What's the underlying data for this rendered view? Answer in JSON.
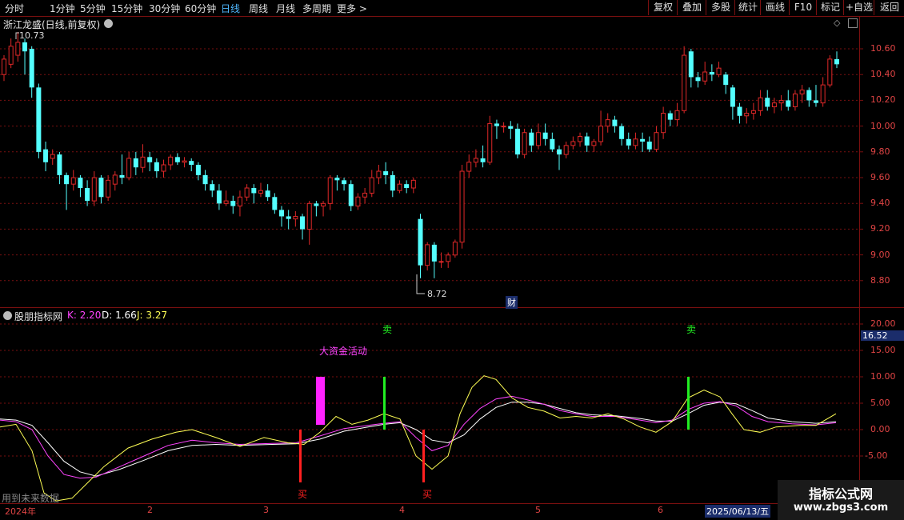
{
  "toolbar": {
    "periods": [
      {
        "label": "分时",
        "active": false
      },
      {
        "label": "1分钟",
        "active": false
      },
      {
        "label": "5分钟",
        "active": false
      },
      {
        "label": "15分钟",
        "active": false
      },
      {
        "label": "30分钟",
        "active": false
      },
      {
        "label": "60分钟",
        "active": false
      },
      {
        "label": "日线",
        "active": true
      },
      {
        "label": "周线",
        "active": false
      },
      {
        "label": "月线",
        "active": false
      },
      {
        "label": "多周期",
        "active": false
      },
      {
        "label": "更多 >",
        "active": false
      }
    ],
    "actions": [
      "复权",
      "叠加",
      "多股",
      "统计",
      "画线",
      "F10",
      "标记",
      "+自选",
      "返回"
    ]
  },
  "main_panel": {
    "title": "浙江龙盛(日线,前复权)",
    "y_ticks": [
      "10.60",
      "10.40",
      "10.20",
      "10.00",
      "9.80",
      "9.60",
      "9.40",
      "9.20",
      "9.00",
      "8.80"
    ],
    "high_label": "10.73",
    "low_label": "8.72",
    "finance_marker": "财"
  },
  "indicator_panel": {
    "name": "股朋指标网",
    "k_label": "K: 2.20",
    "d_label": "D: 1.66",
    "j_label": "J: 3.27",
    "y_ticks": [
      "20.00",
      "15.00",
      "10.00",
      "5.00",
      "0.00",
      "-5.00"
    ],
    "current_value": "16.52",
    "big_money_label": "大资金活动",
    "signals": [
      {
        "type": "sell",
        "text": "卖"
      },
      {
        "type": "sell",
        "text": "卖"
      },
      {
        "type": "buy",
        "text": "买"
      },
      {
        "type": "buy",
        "text": "买"
      }
    ],
    "future_data_note": "用到未来数据"
  },
  "time_axis": {
    "labels": [
      "2024年",
      "2",
      "3",
      "4",
      "5",
      "6"
    ],
    "cursor_date": "2025/06/13/五"
  },
  "watermark": {
    "title": "指标公式网",
    "url": "www.zbgs3.com"
  },
  "colors": {
    "up": "#e02828",
    "down": "#54ffff",
    "k_line": "#ffffff",
    "d_line": "#ff44ff",
    "j_line": "#ffff55",
    "buy": "#ff2020",
    "sell": "#22ee22",
    "big_money": "#ff22ff",
    "grid": "#7a1010"
  },
  "chart_data": {
    "type": "candlestick",
    "ylim": [
      8.7,
      10.75
    ],
    "candles": [
      [
        10.4,
        10.52,
        10.35,
        10.55
      ],
      [
        10.48,
        10.62,
        10.45,
        10.68
      ],
      [
        10.55,
        10.65,
        10.5,
        10.73
      ],
      [
        10.65,
        10.58,
        10.4,
        10.68
      ],
      [
        10.6,
        10.3,
        10.22,
        10.62
      ],
      [
        10.3,
        9.8,
        9.75,
        10.33
      ],
      [
        9.82,
        9.72,
        9.65,
        9.88
      ],
      [
        9.75,
        9.78,
        9.7,
        9.82
      ],
      [
        9.78,
        9.62,
        9.55,
        9.8
      ],
      [
        9.62,
        9.55,
        9.35,
        9.64
      ],
      [
        9.55,
        9.6,
        9.5,
        9.66
      ],
      [
        9.6,
        9.52,
        9.45,
        9.62
      ],
      [
        9.52,
        9.42,
        9.38,
        9.58
      ],
      [
        9.42,
        9.6,
        9.38,
        9.65
      ],
      [
        9.6,
        9.45,
        9.4,
        9.62
      ],
      [
        9.45,
        9.58,
        9.42,
        9.62
      ],
      [
        9.55,
        9.62,
        9.5,
        9.65
      ],
      [
        9.62,
        9.6,
        9.55,
        9.78
      ],
      [
        9.6,
        9.75,
        9.58,
        9.8
      ],
      [
        9.75,
        9.68,
        9.62,
        9.8
      ],
      [
        9.68,
        9.76,
        9.64,
        9.86
      ],
      [
        9.76,
        9.72,
        9.65,
        9.8
      ],
      [
        9.72,
        9.65,
        9.6,
        9.75
      ],
      [
        9.65,
        9.7,
        9.6,
        9.74
      ],
      [
        9.7,
        9.76,
        9.66,
        9.78
      ],
      [
        9.76,
        9.72,
        9.7,
        9.79
      ],
      [
        9.72,
        9.73,
        9.68,
        9.76
      ],
      [
        9.73,
        9.7,
        9.65,
        9.75
      ],
      [
        9.7,
        9.62,
        9.58,
        9.72
      ],
      [
        9.62,
        9.55,
        9.5,
        9.66
      ],
      [
        9.55,
        9.5,
        9.45,
        9.58
      ],
      [
        9.5,
        9.4,
        9.35,
        9.55
      ],
      [
        9.4,
        9.42,
        9.38,
        9.5
      ],
      [
        9.42,
        9.38,
        9.32,
        9.46
      ],
      [
        9.38,
        9.45,
        9.3,
        9.5
      ],
      [
        9.45,
        9.52,
        9.42,
        9.55
      ],
      [
        9.52,
        9.48,
        9.4,
        9.55
      ],
      [
        9.48,
        9.5,
        9.45,
        9.56
      ],
      [
        9.5,
        9.45,
        9.42,
        9.55
      ],
      [
        9.45,
        9.35,
        9.32,
        9.48
      ],
      [
        9.35,
        9.3,
        9.22,
        9.38
      ],
      [
        9.3,
        9.28,
        9.2,
        9.35
      ],
      [
        9.28,
        9.3,
        9.22,
        9.34
      ],
      [
        9.3,
        9.2,
        9.12,
        9.32
      ],
      [
        9.2,
        9.4,
        9.08,
        9.42
      ],
      [
        9.4,
        9.38,
        9.3,
        9.42
      ],
      [
        9.38,
        9.4,
        9.3,
        9.42
      ],
      [
        9.4,
        9.6,
        9.35,
        9.62
      ],
      [
        9.6,
        9.58,
        9.5,
        9.62
      ],
      [
        9.58,
        9.55,
        9.5,
        9.6
      ],
      [
        9.55,
        9.38,
        9.34,
        9.58
      ],
      [
        9.38,
        9.45,
        9.35,
        9.48
      ],
      [
        9.45,
        9.48,
        9.4,
        9.52
      ],
      [
        9.48,
        9.6,
        9.45,
        9.66
      ],
      [
        9.6,
        9.65,
        9.55,
        9.7
      ],
      [
        9.65,
        9.62,
        9.55,
        9.72
      ],
      [
        9.62,
        9.5,
        9.45,
        9.65
      ],
      [
        9.5,
        9.55,
        9.48,
        9.58
      ],
      [
        9.55,
        9.52,
        9.48,
        9.58
      ],
      [
        9.52,
        9.58,
        9.48,
        9.6
      ],
      [
        9.28,
        8.92,
        8.82,
        9.32
      ],
      [
        8.92,
        9.08,
        8.88,
        9.1
      ],
      [
        9.08,
        8.95,
        8.82,
        9.1
      ],
      [
        8.95,
        8.95,
        8.9,
        9.02
      ],
      [
        8.95,
        9.0,
        8.9,
        9.02
      ],
      [
        9.0,
        9.1,
        8.98,
        9.12
      ],
      [
        9.1,
        9.65,
        9.05,
        9.7
      ],
      [
        9.65,
        9.72,
        9.6,
        9.78
      ],
      [
        9.72,
        9.75,
        9.68,
        9.82
      ],
      [
        9.75,
        9.72,
        9.68,
        9.85
      ],
      [
        9.72,
        10.02,
        9.7,
        10.08
      ],
      [
        10.02,
        10.0,
        9.9,
        10.05
      ],
      [
        10.0,
        10.0,
        9.95,
        10.03
      ],
      [
        10.0,
        9.98,
        9.9,
        10.04
      ],
      [
        9.98,
        9.78,
        9.75,
        10.02
      ],
      [
        9.78,
        9.95,
        9.75,
        9.98
      ],
      [
        9.95,
        9.85,
        9.8,
        9.98
      ],
      [
        9.85,
        9.95,
        9.82,
        10.02
      ],
      [
        9.95,
        9.9,
        9.85,
        10.02
      ],
      [
        9.9,
        9.82,
        9.8,
        9.95
      ],
      [
        9.82,
        9.78,
        9.66,
        9.85
      ],
      [
        9.78,
        9.85,
        9.75,
        9.88
      ],
      [
        9.85,
        9.88,
        9.82,
        9.92
      ],
      [
        9.88,
        9.92,
        9.84,
        9.95
      ],
      [
        9.92,
        9.85,
        9.8,
        9.95
      ],
      [
        9.85,
        9.88,
        9.8,
        9.9
      ],
      [
        9.88,
        10.0,
        9.85,
        10.12
      ],
      [
        10.0,
        10.05,
        9.95,
        10.1
      ],
      [
        10.05,
        10.0,
        9.95,
        10.08
      ],
      [
        10.0,
        9.9,
        9.85,
        10.02
      ],
      [
        9.9,
        9.85,
        9.82,
        9.95
      ],
      [
        9.85,
        9.9,
        9.82,
        9.95
      ],
      [
        9.9,
        9.88,
        9.8,
        9.95
      ],
      [
        9.88,
        9.82,
        9.8,
        9.92
      ],
      [
        9.82,
        9.95,
        9.8,
        10.0
      ],
      [
        9.95,
        10.1,
        9.9,
        10.15
      ],
      [
        10.1,
        10.05,
        10.0,
        10.12
      ],
      [
        10.05,
        10.12,
        10.0,
        10.18
      ],
      [
        10.12,
        10.55,
        10.1,
        10.62
      ],
      [
        10.58,
        10.38,
        10.3,
        10.6
      ],
      [
        10.38,
        10.35,
        10.3,
        10.42
      ],
      [
        10.35,
        10.42,
        10.32,
        10.5
      ],
      [
        10.42,
        10.4,
        10.35,
        10.48
      ],
      [
        10.4,
        10.45,
        10.38,
        10.5
      ],
      [
        10.4,
        10.32,
        10.25,
        10.42
      ],
      [
        10.3,
        10.15,
        10.05,
        10.32
      ],
      [
        10.15,
        10.08,
        10.02,
        10.18
      ],
      [
        10.08,
        10.1,
        10.02,
        10.14
      ],
      [
        10.1,
        10.12,
        10.05,
        10.18
      ],
      [
        10.12,
        10.22,
        10.08,
        10.28
      ],
      [
        10.22,
        10.15,
        10.12,
        10.28
      ],
      [
        10.15,
        10.18,
        10.1,
        10.22
      ],
      [
        10.18,
        10.2,
        10.12,
        10.24
      ],
      [
        10.2,
        10.15,
        10.12,
        10.28
      ],
      [
        10.15,
        10.25,
        10.12,
        10.28
      ],
      [
        10.25,
        10.28,
        10.18,
        10.32
      ],
      [
        10.28,
        10.2,
        10.15,
        10.3
      ],
      [
        10.2,
        10.18,
        10.15,
        10.32
      ],
      [
        10.18,
        10.32,
        10.15,
        10.38
      ],
      [
        10.32,
        10.52,
        10.3,
        10.55
      ],
      [
        10.52,
        10.48,
        10.45,
        10.58
      ]
    ]
  }
}
